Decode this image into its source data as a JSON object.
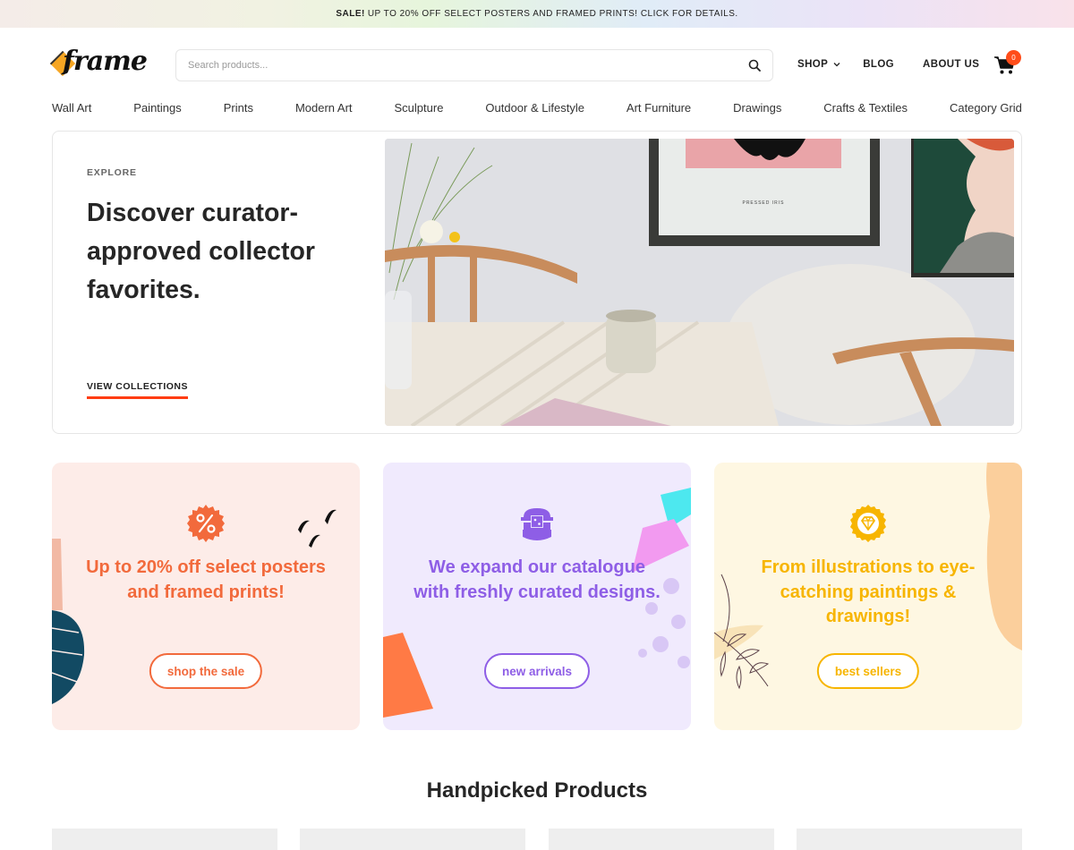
{
  "announcement": {
    "bold": "SALE!",
    "text": "UP TO 20% OFF SELECT POSTERS AND FRAMED PRINTS! CLICK FOR DETAILS."
  },
  "header": {
    "logo_text": "frame",
    "search": {
      "placeholder": "Search products...",
      "value": "",
      "icon": "search-icon"
    },
    "nav": [
      {
        "label": "SHOP",
        "has_dropdown": true
      },
      {
        "label": "BLOG"
      },
      {
        "label": "ABOUT US"
      }
    ],
    "cart": {
      "icon": "cart-icon",
      "count": "0"
    }
  },
  "categories": [
    "Wall Art",
    "Paintings",
    "Prints",
    "Modern Art",
    "Sculpture",
    "Outdoor & Lifestyle",
    "Art Furniture",
    "Drawings",
    "Crafts & Textiles",
    "Category Grid"
  ],
  "hero": {
    "eyebrow": "EXPLORE",
    "title": "Discover curator-approved collector favorites.",
    "cta": "VIEW COLLECTIONS",
    "image_alt": "Dining table with framed prints on wall",
    "poster_caption": "PRESSED IRIS"
  },
  "promos": [
    {
      "icon": "percent-badge-icon",
      "text": "Up to 20% off select posters and framed prints!",
      "button": "shop the sale",
      "color": "#f26a3c"
    },
    {
      "icon": "shopping-basket-icon",
      "text": "We expand our catalogue with freshly curated designs.",
      "button": "new arrivals",
      "color": "#8e5ee6"
    },
    {
      "icon": "diamond-badge-icon",
      "text": "From illustrations to eye-catching paintings & drawings!",
      "button": "best sellers",
      "color": "#f7b500"
    }
  ],
  "products_section": {
    "title": "Handpicked Products"
  },
  "colors": {
    "accent": "#ff3d12",
    "badge": "#ff4d1a"
  }
}
